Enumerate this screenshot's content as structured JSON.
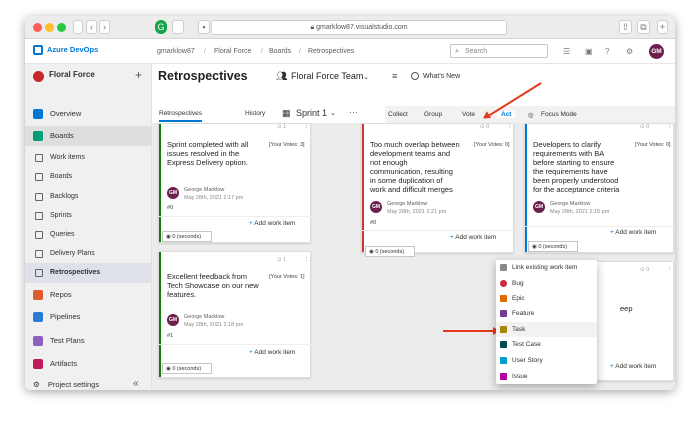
{
  "browser": {
    "url": "gmarklow87.visualstudio.com",
    "back_label": "‹",
    "forward_label": "›"
  },
  "header": {
    "brand": "Azure DevOps",
    "breadcrumb": [
      "gmarklow87",
      "Floral Force",
      "Boards",
      "Retrospectives"
    ],
    "search_placeholder": "Search",
    "avatar_initials": "GM"
  },
  "sidebar": {
    "project": "Floral Force",
    "items": [
      {
        "label": "Overview",
        "color": "#0078d4"
      },
      {
        "label": "Boards",
        "color": "#009b77"
      },
      {
        "label": "Work items"
      },
      {
        "label": "Boards"
      },
      {
        "label": "Backlogs"
      },
      {
        "label": "Sprints"
      },
      {
        "label": "Queries"
      },
      {
        "label": "Delivery Plans"
      },
      {
        "label": "Retrospectives"
      },
      {
        "label": "Repos",
        "color": "#e05b2b"
      },
      {
        "label": "Pipelines",
        "color": "#2e7bd6"
      },
      {
        "label": "Test Plans",
        "color": "#8b5fbf"
      },
      {
        "label": "Artifacts",
        "color": "#c2185b"
      }
    ],
    "settings": "Project settings"
  },
  "main": {
    "title": "Retrospectives",
    "team": "Floral Force Team",
    "whats_new": "What's New",
    "tabs": [
      "Retrospectives",
      "History"
    ],
    "sprint": "Sprint 1",
    "phases": [
      "Collect",
      "Group",
      "Vote",
      "Act"
    ],
    "focus_mode": "Focus Mode"
  },
  "cards": [
    {
      "text": [
        "Sprint completed with all",
        "issues resolved in the",
        "Express Delivery option."
      ],
      "votes": "[Your Votes: 3]",
      "author": "George Marklow",
      "date": "May 28th, 2021 2:17 pm",
      "num": "#0",
      "add": "Add work item",
      "timer": "0 (seconds)",
      "counter": "1",
      "color": "#107c10"
    },
    {
      "text": [
        "Excellent feedback from",
        "Tech Showcase on our new",
        "features."
      ],
      "votes": "[Your Votes: 1]",
      "author": "George Marklow",
      "date": "May 28th, 2021 2:18 pm",
      "num": "#1",
      "add": "Add work item",
      "timer": "0 (seconds)",
      "counter": "1",
      "color": "#107c10"
    },
    {
      "text": [
        "Too much overlap between",
        "development teams and",
        "not enough",
        "communication, resulting",
        "in some duplication of",
        "work and difficult merges"
      ],
      "votes": "[Your Votes: 0]",
      "author": "George Marklow",
      "date": "May 28th, 2021 2:21 pm",
      "num": "#0",
      "add": "Add work item",
      "timer": "0 (seconds)",
      "counter": "0",
      "color": "#d13438"
    },
    {
      "text": [
        "Developers to clarify",
        "requirements with BA",
        "before starting to ensure",
        "the requirements have",
        "been properly understood",
        "for the acceptance criteria"
      ],
      "votes": "[Your Votes: 0]",
      "author": "George Marklow",
      "date": "May 28th, 2021 2:15 pm",
      "add": "Add work item",
      "timer": "0 (seconds)",
      "counter": "0",
      "color": "#0078d4"
    },
    {
      "text": [
        "eep"
      ],
      "add": "Add work item",
      "counter": "0",
      "color": "#0078d4"
    }
  ],
  "menu": {
    "items": [
      {
        "label": "Link existing work item",
        "color": "#888"
      },
      {
        "label": "Bug",
        "color": "#cc293d"
      },
      {
        "label": "Epic",
        "color": "#e06c00"
      },
      {
        "label": "Feature",
        "color": "#773b93"
      },
      {
        "label": "Task",
        "color": "#a4880a"
      },
      {
        "label": "Test Case",
        "color": "#004b50"
      },
      {
        "label": "User Story",
        "color": "#009ccc"
      },
      {
        "label": "Issue",
        "color": "#b4009e"
      }
    ]
  }
}
